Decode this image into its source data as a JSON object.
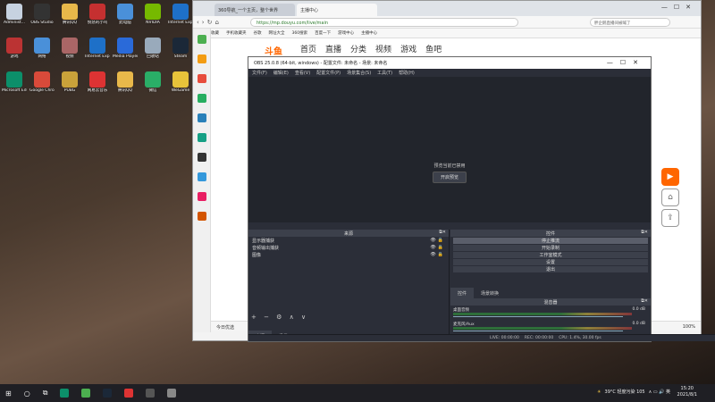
{
  "desktop_icons": [
    {
      "label": "Administ...",
      "color": "#c7d2e0"
    },
    {
      "label": "OBS Studio",
      "color": "#333"
    },
    {
      "label": "腾讯QQ",
      "color": "#e8b84a"
    },
    {
      "label": "愤怒的小鸟",
      "color": "#c53030"
    },
    {
      "label": "此电脑",
      "color": "#4a90d9"
    },
    {
      "label": "NVIDIA",
      "color": "#76b900"
    },
    {
      "label": "Internet Explorer",
      "color": "#1e70c8"
    },
    {
      "label": "游戏",
      "color": "#b33"
    },
    {
      "label": "网络",
      "color": "#4a90d9"
    },
    {
      "label": "视频",
      "color": "#a66"
    },
    {
      "label": "Internet Explorer",
      "color": "#1e70c8"
    },
    {
      "label": "Media Player",
      "color": "#2a6ad9"
    },
    {
      "label": "回收站",
      "color": "#9ab"
    },
    {
      "label": "Steam",
      "color": "#1b2838"
    },
    {
      "label": "Microsoft Edge",
      "color": "#0c8f6a"
    },
    {
      "label": "Google Chrome",
      "color": "#d94a3a"
    },
    {
      "label": "PUBG",
      "color": "#c9a23a"
    },
    {
      "label": "网易云音乐",
      "color": "#d33"
    },
    {
      "label": "腾讯QQ",
      "color": "#e8b84a"
    },
    {
      "label": "微信",
      "color": "#2aae67"
    },
    {
      "label": "WeGame",
      "color": "#e8c33a"
    }
  ],
  "browser": {
    "tabs": [
      "360导航_一个主页，整个世界",
      "主播中心"
    ],
    "url": "https://mp.douyu.com/live/main",
    "search_placeholder": "胖企鹅直播间被喊了",
    "bookmarks": [
      "收藏",
      "手机收藏夹",
      "谷歌",
      "网址大全",
      "360搜索",
      "百度一下",
      "游戏中心",
      "主播中心"
    ],
    "site_logo": "斗鱼",
    "site_nav": [
      "首页",
      "直播",
      "分类",
      "视频",
      "游戏",
      "鱼吧"
    ],
    "status_left": "今日优选",
    "status_right": "100%"
  },
  "obs": {
    "title": "OBS 25.0.8 (64-bit, windows) - 配置文件: 未命名 - 场景: 未命名",
    "menu": [
      "文件(F)",
      "编辑(E)",
      "查看(V)",
      "配置文件(P)",
      "场景集合(S)",
      "工具(T)",
      "帮助(H)"
    ],
    "preview_message": "预览当前已禁用",
    "preview_button": "开启预览",
    "sources_title": "来源",
    "sources": [
      "显示器捕获",
      "音频输出捕获",
      "图像"
    ],
    "source_tabs": [
      "来源",
      "场景"
    ],
    "controls_title": "控件",
    "controls": [
      "停止推流",
      "开始录制",
      "工作室模式",
      "设置",
      "退出"
    ],
    "control_tabs": [
      "控件",
      "场景转换"
    ],
    "mixer_title": "混音器",
    "mixer": [
      {
        "name": "桌面音频",
        "db": "0.0 dB"
      },
      {
        "name": "麦克风/Aux",
        "db": "0.0 dB"
      }
    ],
    "status": [
      "LIVE: 00:00:00",
      "REC: 00:00:00",
      "CPU: 1.4%, 30.00 fps"
    ]
  },
  "taskbar": {
    "temperature": "39°C 轻度污染 105",
    "time": "15:20",
    "date": "2021/8/1"
  }
}
